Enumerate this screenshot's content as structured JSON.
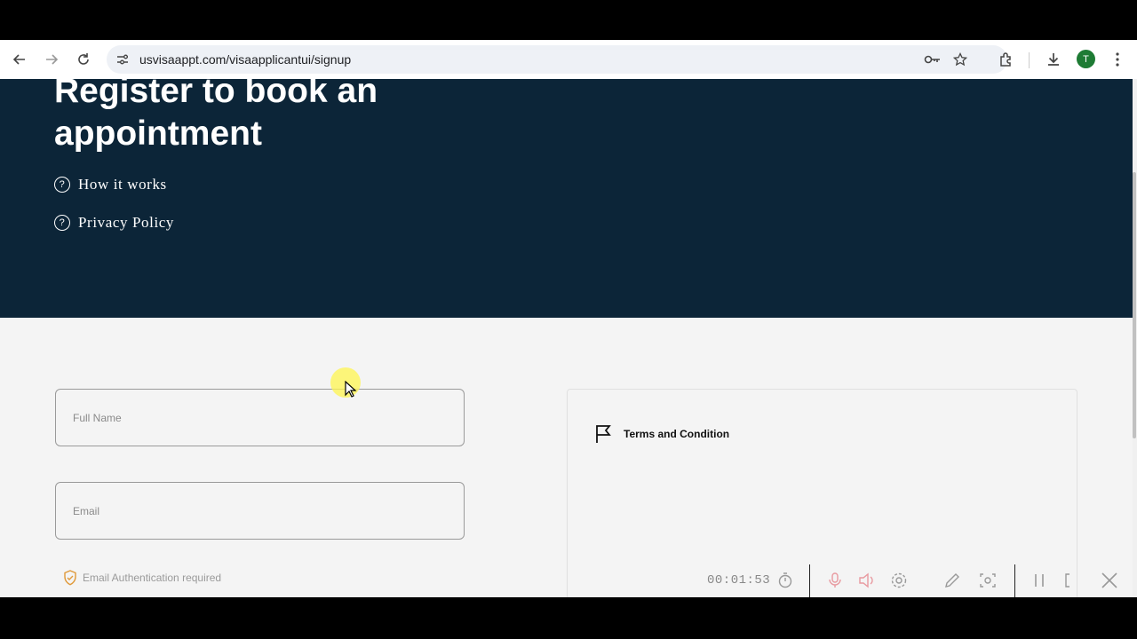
{
  "browser": {
    "url": "usvisaappt.com/visaapplicantui/signup",
    "profile_initial": "T",
    "nav": {
      "back_icon": "arrow-left-icon",
      "forward_icon": "arrow-right-icon",
      "reload_icon": "reload-icon"
    }
  },
  "hero": {
    "title": "Register to book an appointment",
    "links": [
      {
        "label": "How it works",
        "icon": "question-circle-icon"
      },
      {
        "label": "Privacy Policy",
        "icon": "question-circle-icon"
      }
    ]
  },
  "form": {
    "full_name_placeholder": "Full Name",
    "email_placeholder": "Email",
    "auth_note": "Email Authentication required"
  },
  "terms": {
    "title": "Terms and Condition",
    "icon": "flag-icon"
  },
  "recorder": {
    "time": "00:01:53"
  },
  "colors": {
    "hero_bg": "#0c2538",
    "page_bg": "#f4f4f4",
    "avatar_bg": "#1e7b34",
    "shield": "#e09a3a"
  }
}
